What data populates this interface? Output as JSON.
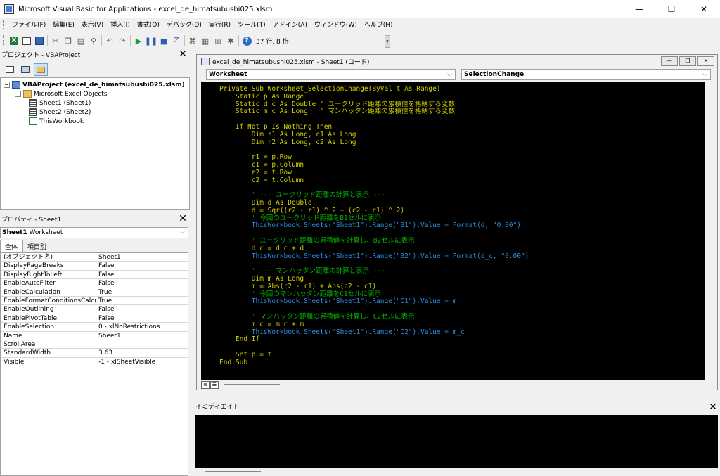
{
  "window": {
    "title": "Microsoft Visual Basic for Applications - excel_de_himatsubushi025.xlsm",
    "controls": [
      "—",
      "☐",
      "✕"
    ]
  },
  "menu": [
    "ファイル(F)",
    "編集(E)",
    "表示(V)",
    "挿入(I)",
    "書式(O)",
    "デバッグ(D)",
    "実行(R)",
    "ツール(T)",
    "アドイン(A)",
    "ウィンドウ(W)",
    "ヘルプ(H)"
  ],
  "toolbar": {
    "status": "37 行, 8 桁",
    "icons": [
      "excel-icon",
      "insert-module-icon",
      "save-icon",
      "cut-icon",
      "copy-icon",
      "paste-icon",
      "find-icon",
      "undo-icon",
      "redo-icon",
      "run-icon",
      "break-icon",
      "reset-icon",
      "design-mode-icon",
      "project-explorer-icon",
      "properties-icon",
      "object-browser-icon",
      "toolbox-icon",
      "help-icon"
    ]
  },
  "project": {
    "title": "プロジェクト - VBAProject",
    "root": "VBAProject (excel_de_himatsubushi025.xlsm)",
    "folder": "Microsoft Excel Objects",
    "items": [
      "Sheet1 (Sheet1)",
      "Sheet2 (Sheet2)",
      "ThisWorkbook"
    ]
  },
  "properties": {
    "title": "プロパティ - Sheet1",
    "object_name": "Sheet1",
    "object_type": "Worksheet",
    "tabs": [
      "全体",
      "項目別"
    ],
    "rows": [
      {
        "name": "(オブジェクト名)",
        "value": "Sheet1"
      },
      {
        "name": "DisplayPageBreaks",
        "value": "False"
      },
      {
        "name": "DisplayRightToLeft",
        "value": "False"
      },
      {
        "name": "EnableAutoFilter",
        "value": "False"
      },
      {
        "name": "EnableCalculation",
        "value": "True"
      },
      {
        "name": "EnableFormatConditionsCalculation",
        "value": "True"
      },
      {
        "name": "EnableOutlining",
        "value": "False"
      },
      {
        "name": "EnablePivotTable",
        "value": "False"
      },
      {
        "name": "EnableSelection",
        "value": "0 - xlNoRestrictions"
      },
      {
        "name": "Name",
        "value": "Sheet1"
      },
      {
        "name": "ScrollArea",
        "value": ""
      },
      {
        "name": "StandardWidth",
        "value": "3.63"
      },
      {
        "name": "Visible",
        "value": "-1 - xlSheetVisible"
      }
    ]
  },
  "code_window": {
    "title": "excel_de_himatsubushi025.xlsm - Sheet1 (コード)",
    "object_combo": "Worksheet",
    "proc_combo": "SelectionChange",
    "lines": [
      {
        "text": "Private Sub Worksheet_SelectionChange(ByVal t As Range)",
        "kind": "code"
      },
      {
        "text": "    Static p As Range",
        "kind": "code"
      },
      {
        "text": "    Static d_c As Double ' ユークリッド距離の累積値を格納する変数",
        "kind": "code"
      },
      {
        "text": "    Static m_c As Long   ' マンハッタン距離の累積値を格納する変数",
        "kind": "code"
      },
      {
        "text": "",
        "kind": "code"
      },
      {
        "text": "    If Not p Is Nothing Then",
        "kind": "code"
      },
      {
        "text": "        Dim r1 As Long, c1 As Long",
        "kind": "code"
      },
      {
        "text": "        Dim r2 As Long, c2 As Long",
        "kind": "code"
      },
      {
        "text": "",
        "kind": "code"
      },
      {
        "text": "        r1 = p.Row",
        "kind": "code"
      },
      {
        "text": "        c1 = p.Column",
        "kind": "code"
      },
      {
        "text": "        r2 = t.Row",
        "kind": "code"
      },
      {
        "text": "        c2 = t.Column",
        "kind": "code"
      },
      {
        "text": "",
        "kind": "code"
      },
      {
        "text": "        ' --- ユークリッド距離の計算と表示 ---",
        "kind": "cmt"
      },
      {
        "text": "        Dim d As Double",
        "kind": "code"
      },
      {
        "text": "        d = Sqr((r2 - r1) ^ 2 + (c2 - c1) ^ 2)",
        "kind": "code"
      },
      {
        "text": "        ' 今回のユークリッド距離をB1セルに表示",
        "kind": "cmt"
      },
      {
        "text": "        ThisWorkbook.Sheets(\"Sheet1\").Range(\"B1\").Value = Format(d, \"0.00\")",
        "kind": "acc"
      },
      {
        "text": "",
        "kind": "code"
      },
      {
        "text": "        ' ユークリッド距離の累積値を計算し、B2セルに表示",
        "kind": "cmt"
      },
      {
        "text": "        d_c = d_c + d",
        "kind": "code"
      },
      {
        "text": "        ThisWorkbook.Sheets(\"Sheet1\").Range(\"B2\").Value = Format(d_c, \"0.00\")",
        "kind": "acc"
      },
      {
        "text": "",
        "kind": "code"
      },
      {
        "text": "        ' --- マンハッタン距離の計算と表示 ---",
        "kind": "cmt"
      },
      {
        "text": "        Dim m As Long",
        "kind": "code"
      },
      {
        "text": "        m = Abs(r2 - r1) + Abs(c2 - c1)",
        "kind": "code"
      },
      {
        "text": "        ' 今回のマンハッタン距離をC1セルに表示",
        "kind": "cmt"
      },
      {
        "text": "        ThisWorkbook.Sheets(\"Sheet1\").Range(\"C1\").Value = m",
        "kind": "acc"
      },
      {
        "text": "",
        "kind": "code"
      },
      {
        "text": "        ' マンハッタン距離の累積値を計算し、C2セルに表示",
        "kind": "cmt"
      },
      {
        "text": "        m_c = m_c + m",
        "kind": "code"
      },
      {
        "text": "        ThisWorkbook.Sheets(\"Sheet1\").Range(\"C2\").Value = m_c",
        "kind": "acc"
      },
      {
        "text": "    End If",
        "kind": "code"
      },
      {
        "text": "",
        "kind": "code"
      },
      {
        "text": "    Set p = t",
        "kind": "code"
      },
      {
        "text": "End Sub",
        "kind": "code"
      }
    ]
  },
  "immediate": {
    "title": "イミディエイト"
  },
  "colors": {
    "code_bg": "#000000",
    "code_text": "#d0d000",
    "comment": "#00b000",
    "accessor": "#2a8fe0"
  }
}
